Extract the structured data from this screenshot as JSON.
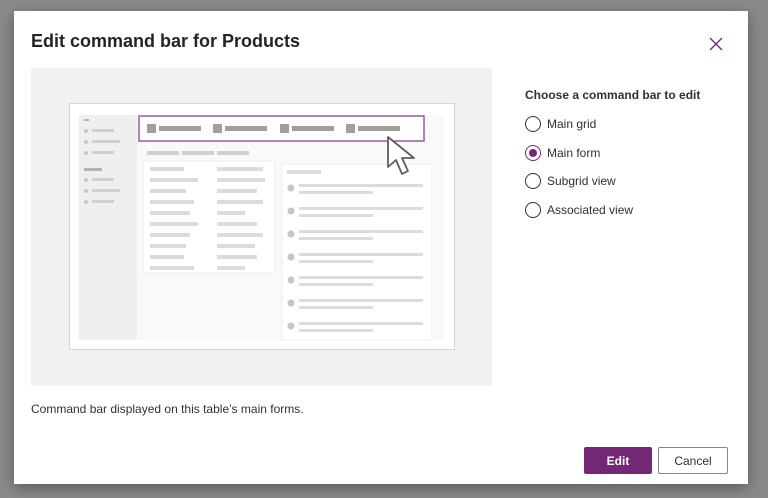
{
  "dialog": {
    "title": "Edit command bar for Products",
    "description": "Command bar displayed on this table’s main forms.",
    "chooser_label": "Choose a command bar to edit",
    "options": [
      {
        "label": "Main grid",
        "selected": false
      },
      {
        "label": "Main form",
        "selected": true
      },
      {
        "label": "Subgrid view",
        "selected": false
      },
      {
        "label": "Associated view",
        "selected": false
      }
    ],
    "buttons": {
      "primary": "Edit",
      "secondary": "Cancel"
    },
    "icons": {
      "close": "close-icon",
      "cursor": "pointer-cursor-icon"
    }
  },
  "colors": {
    "accent": "#742774",
    "overlay": "#8a8a8a",
    "preview_bg": "#f2f1f0"
  }
}
